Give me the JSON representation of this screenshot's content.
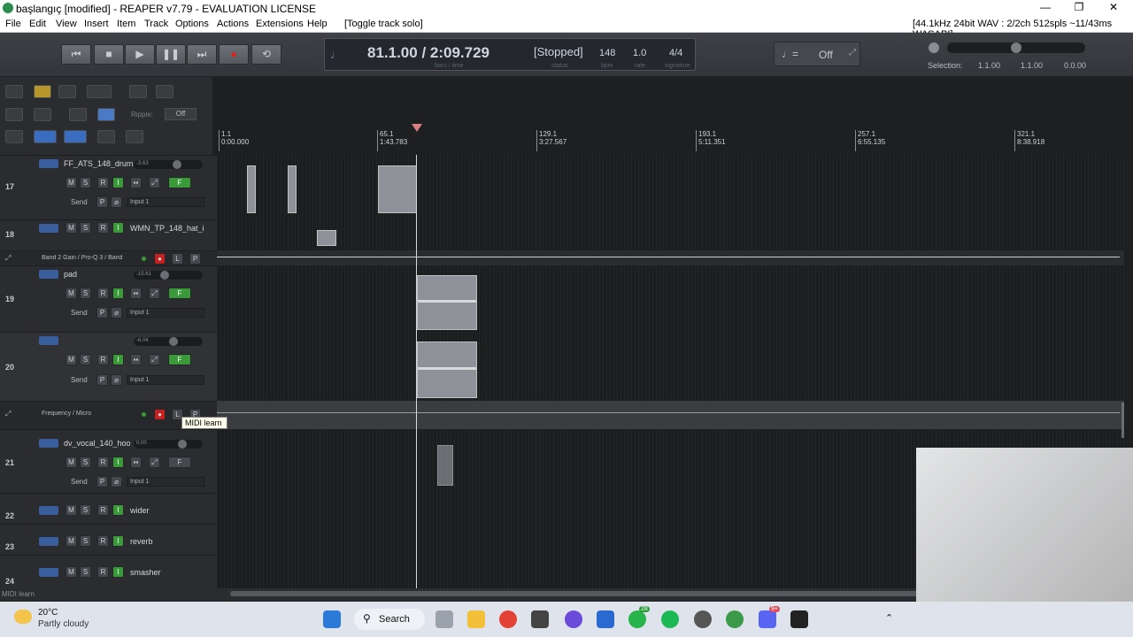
{
  "window": {
    "title": "başlangıç [modified] - REAPER v7.79 - EVALUATION LICENSE",
    "minimize": "—",
    "maximize": "❐",
    "close": "✕"
  },
  "menubar": {
    "items": [
      "File",
      "Edit",
      "View",
      "Insert",
      "Item",
      "Track",
      "Options",
      "Actions",
      "Extensions",
      "Help"
    ],
    "action_hint": "[Toggle track solo]",
    "audio_info": "[44.1kHz 24bit WAV : 2/2ch 512spls ~11/43ms WASAPI]"
  },
  "transport": {
    "position": "81.1.00 / 2:09.729",
    "position_sub": "bars / time",
    "status": "[Stopped]",
    "status_sub": "status",
    "bpm": "148",
    "bpm_sub": "bpm",
    "rate": "1.0",
    "rate_sub": "rate",
    "signature": "4/4",
    "signature_sub": "signature",
    "metronome_state": "Off",
    "selection_label": "Selection:",
    "selection_start": "1.1.00",
    "selection_end": "1.1.00",
    "selection_len": "0.0.00"
  },
  "toolbar": {
    "ripple_label": "Ripple:",
    "ripple_value": "Off"
  },
  "ruler": {
    "marks": [
      {
        "bar": "1.1",
        "time": "0:00.000"
      },
      {
        "bar": "65.1",
        "time": "1:43.783"
      },
      {
        "bar": "129.1",
        "time": "3:27.567"
      },
      {
        "bar": "193.1",
        "time": "5:11.351"
      },
      {
        "bar": "257.1",
        "time": "6:55.135"
      },
      {
        "bar": "321.1",
        "time": "8:38.918"
      }
    ]
  },
  "tracks": [
    {
      "num": "17",
      "name": "FF_ATS_148_drum",
      "vol": "-3.63",
      "send": "Send",
      "input": "Input 1"
    },
    {
      "num": "18",
      "name": "WMN_TP_148_hat_i"
    },
    {
      "envelope": "Band 2 Gain / Pro-Q 3 / Band"
    },
    {
      "num": "19",
      "name": "pad",
      "vol": "-15.61",
      "send": "Send",
      "input": "Input 1"
    },
    {
      "num": "20",
      "name": "",
      "vol": "-6.04",
      "send": "Send",
      "input": "Input 1"
    },
    {
      "envelope": "Frequency / Micro"
    },
    {
      "num": "21",
      "name": "dv_vocal_140_hoo",
      "vol": "0.00",
      "send": "Send",
      "input": "Input 1"
    },
    {
      "num": "22",
      "name": "wider"
    },
    {
      "num": "23",
      "name": "reverb"
    },
    {
      "num": "24",
      "name": "smasher"
    }
  ],
  "track_buttons": {
    "mute": "M",
    "solo": "S",
    "rec": "R",
    "input": "I",
    "phase": "P",
    "fx": "F",
    "env_lock": "L"
  },
  "tooltip": "MIDI learn",
  "status_text": "MIDI learn",
  "taskbar": {
    "temp": "20°C",
    "weather": "Partly cloudy",
    "search": "Search",
    "badge_whatsapp": "28",
    "badge_discord": "9+"
  },
  "colors": {
    "accent_green": "#3a9a3a",
    "record_red": "#cc2222",
    "folder_blue": "#3a5d9c"
  }
}
